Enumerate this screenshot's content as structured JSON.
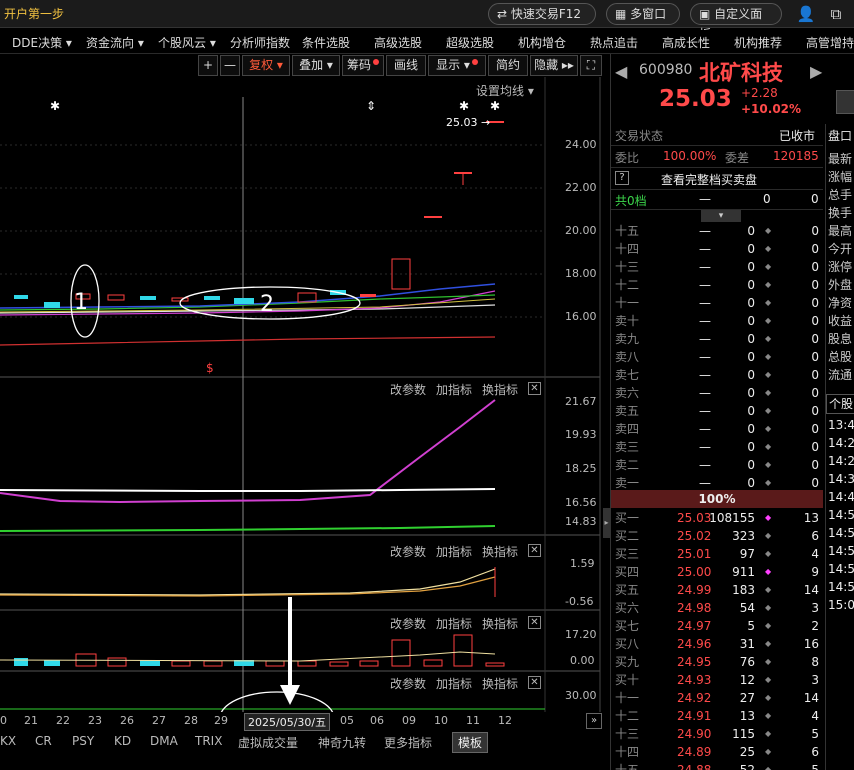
{
  "titlebar": {
    "crumb": "开户第一步",
    "quick_trade": "快速交易F12",
    "multi_window": "多窗口",
    "custom_panel": "自定义面板"
  },
  "menu": [
    "DDE决策 ▾",
    "资金流向 ▾",
    "个股风云 ▾",
    "分析师指数",
    "条件选股",
    "高级选股",
    "超级选股",
    "机构增仓",
    "热点追击",
    "高成长性",
    "机构推荐",
    "高管增持"
  ],
  "toolbar": {
    "plus": "+",
    "minus": "—",
    "fuquan": "复权 ▾",
    "diejia": "叠加 ▾",
    "chouma": "筹码",
    "huaxian": "画线",
    "xianshi": "显示 ▾",
    "jianyue": "简约",
    "yincang": "隐藏 ▸▸",
    "expand": "⛶"
  },
  "main": {
    "settings": "设置均线 ▾",
    "price_tag": "25.03 →",
    "y_ticks": [
      "24.00",
      "22.00",
      "20.00",
      "18.00",
      "16.00"
    ],
    "markers": [
      "✱",
      "⇕",
      "✱",
      "✱"
    ],
    "s_marker": "$",
    "annotation1": "1",
    "annotation2": "2"
  },
  "panels": [
    {
      "ticks": [
        "21.67",
        "19.93",
        "18.25",
        "16.56",
        "14.83"
      ],
      "buttons": [
        "改参数",
        "加指标",
        "换指标"
      ]
    },
    {
      "ticks": [
        "1.59",
        "-0.56"
      ],
      "buttons": [
        "改参数",
        "加指标",
        "换指标"
      ]
    },
    {
      "ticks": [
        "17.20",
        "0.00"
      ],
      "buttons": [
        "改参数",
        "加指标",
        "换指标"
      ]
    },
    {
      "ticks": [
        "30.00"
      ],
      "buttons": [
        "改参数",
        "加指标",
        "换指标"
      ]
    }
  ],
  "xaxis": {
    "dates": [
      "0",
      "21",
      "22",
      "23",
      "26",
      "27",
      "28",
      "29",
      "05",
      "06",
      "09",
      "10",
      "11",
      "12"
    ],
    "cursor_date": "2025/05/30/五"
  },
  "tabs": [
    "KX",
    "CR",
    "PSY",
    "KD",
    "DMA",
    "TRIX",
    "虚拟成交量",
    "神奇九转",
    "更多指标",
    "模板"
  ],
  "quote": {
    "code": "600980",
    "name": "北矿科技",
    "price": "25.03",
    "change": "+2.28",
    "change_pct": "+10.02%",
    "status_label": "交易状态",
    "status_value": "已收市",
    "weibi_label": "委比",
    "weibi_value": "100.00%",
    "weicha_label": "委差",
    "weicha_value": "120185",
    "full_book": "查看完整档买卖盘",
    "total_label": "共0档",
    "ratio_bar": "100%"
  },
  "sells": [
    {
      "label": "十五",
      "price": "—",
      "vol": "0",
      "cnt": "0"
    },
    {
      "label": "十四",
      "price": "—",
      "vol": "0",
      "cnt": "0"
    },
    {
      "label": "十三",
      "price": "—",
      "vol": "0",
      "cnt": "0"
    },
    {
      "label": "十二",
      "price": "—",
      "vol": "0",
      "cnt": "0"
    },
    {
      "label": "十一",
      "price": "—",
      "vol": "0",
      "cnt": "0"
    },
    {
      "label": "卖十",
      "price": "—",
      "vol": "0",
      "cnt": "0"
    },
    {
      "label": "卖九",
      "price": "—",
      "vol": "0",
      "cnt": "0"
    },
    {
      "label": "卖八",
      "price": "—",
      "vol": "0",
      "cnt": "0"
    },
    {
      "label": "卖七",
      "price": "—",
      "vol": "0",
      "cnt": "0"
    },
    {
      "label": "卖六",
      "price": "—",
      "vol": "0",
      "cnt": "0"
    },
    {
      "label": "卖五",
      "price": "—",
      "vol": "0",
      "cnt": "0"
    },
    {
      "label": "卖四",
      "price": "—",
      "vol": "0",
      "cnt": "0"
    },
    {
      "label": "卖三",
      "price": "—",
      "vol": "0",
      "cnt": "0"
    },
    {
      "label": "卖二",
      "price": "—",
      "vol": "0",
      "cnt": "0"
    },
    {
      "label": "卖一",
      "price": "—",
      "vol": "0",
      "cnt": "0"
    }
  ],
  "buys": [
    {
      "label": "买一",
      "price": "25.03",
      "vol": "108155",
      "cnt": "13"
    },
    {
      "label": "买二",
      "price": "25.02",
      "vol": "323",
      "cnt": "6"
    },
    {
      "label": "买三",
      "price": "25.01",
      "vol": "97",
      "cnt": "4"
    },
    {
      "label": "买四",
      "price": "25.00",
      "vol": "911",
      "cnt": "9"
    },
    {
      "label": "买五",
      "price": "24.99",
      "vol": "183",
      "cnt": "14"
    },
    {
      "label": "买六",
      "price": "24.98",
      "vol": "54",
      "cnt": "3"
    },
    {
      "label": "买七",
      "price": "24.97",
      "vol": "5",
      "cnt": "2"
    },
    {
      "label": "买八",
      "price": "24.96",
      "vol": "31",
      "cnt": "16"
    },
    {
      "label": "买九",
      "price": "24.95",
      "vol": "76",
      "cnt": "8"
    },
    {
      "label": "买十",
      "price": "24.93",
      "vol": "12",
      "cnt": "3"
    },
    {
      "label": "十一",
      "price": "24.92",
      "vol": "27",
      "cnt": "14"
    },
    {
      "label": "十二",
      "price": "24.91",
      "vol": "13",
      "cnt": "4"
    },
    {
      "label": "十三",
      "price": "24.90",
      "vol": "115",
      "cnt": "5"
    },
    {
      "label": "十四",
      "price": "24.89",
      "vol": "25",
      "cnt": "6"
    },
    {
      "label": "十五",
      "price": "24.88",
      "vol": "52",
      "cnt": "5"
    }
  ],
  "side_labels": [
    "盘口",
    "最新",
    "涨幅",
    "总手",
    "换手",
    "最高",
    "今开",
    "涨停",
    "外盘",
    "净资",
    "收益",
    "股息",
    "总股",
    "流通"
  ],
  "side_tab": "个股",
  "times": [
    "13:4",
    "14:2",
    "14:2",
    "14:3",
    "14:4",
    "14:5",
    "14:5",
    "14:5",
    "14:5",
    "14:5",
    "15:0"
  ]
}
